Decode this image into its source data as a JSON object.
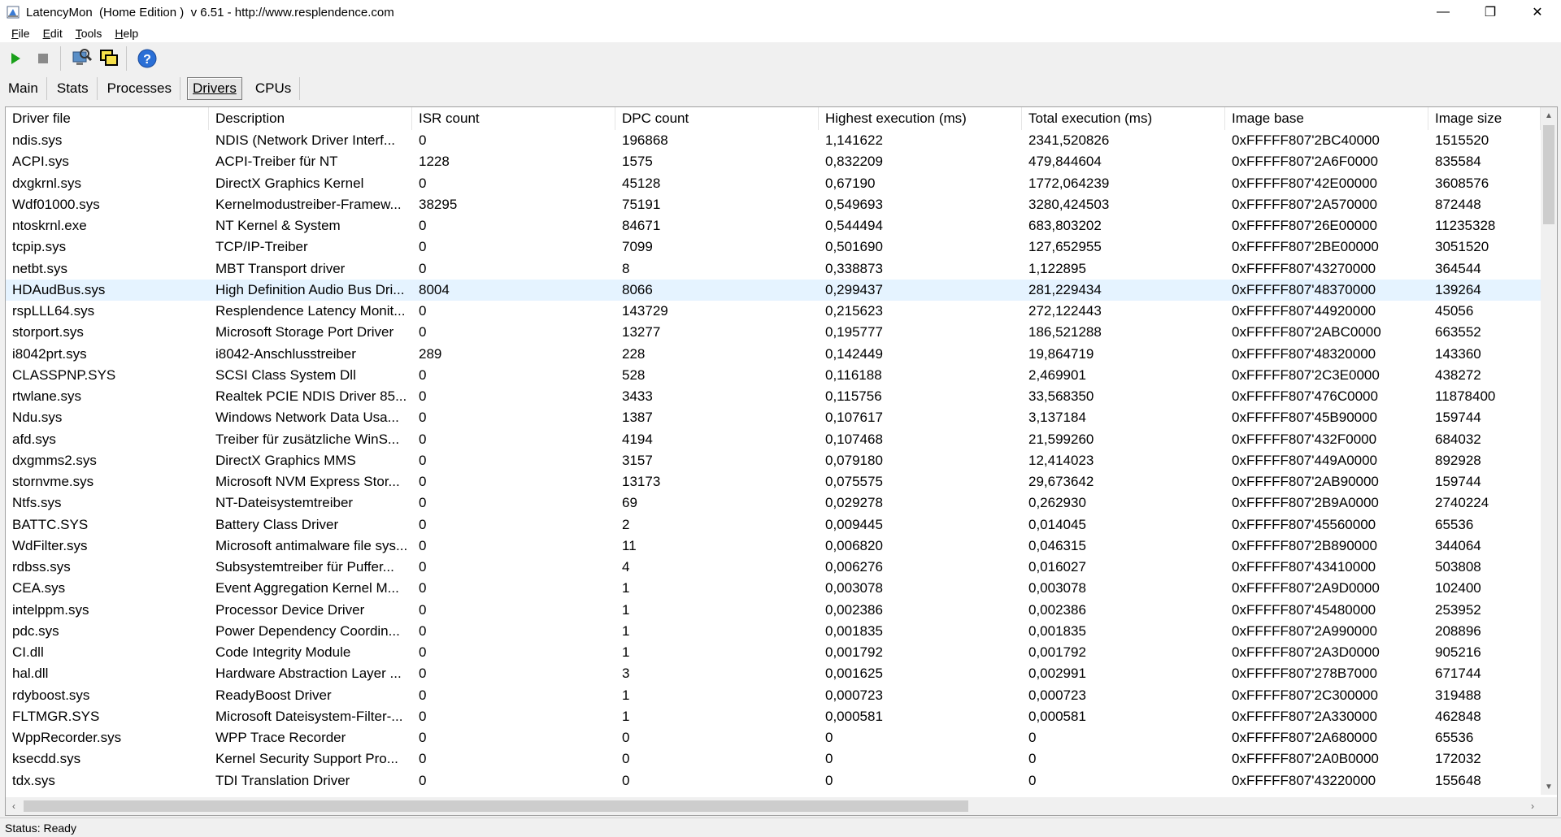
{
  "window": {
    "title": "LatencyMon  (Home Edition )  v 6.51 - http://www.resplendence.com",
    "minimize": "—",
    "restore": "❐",
    "close": "✕"
  },
  "menu": [
    {
      "key": "F",
      "rest": "ile"
    },
    {
      "key": "E",
      "rest": "dit"
    },
    {
      "key": "T",
      "rest": "ools"
    },
    {
      "key": "H",
      "rest": "elp"
    }
  ],
  "toolbar": {
    "icons": [
      "play-icon",
      "stop-icon",
      "search-computer-icon",
      "windows-icon",
      "help-icon"
    ],
    "colors": {
      "play": "#1aa01a",
      "stop": "#8a8a8a",
      "help": "#2a6fd6"
    }
  },
  "tabs": [
    {
      "key": "M",
      "rest": "ain"
    },
    {
      "key": "S",
      "rest": "tats"
    },
    {
      "key": "P",
      "rest": "rocesses"
    },
    {
      "key": "D",
      "rest": "rivers"
    },
    {
      "key": "C",
      "rest": "PUs"
    }
  ],
  "active_tab": "Drivers",
  "table": {
    "columns": [
      "Driver file",
      "Description",
      "ISR count",
      "DPC count",
      "Highest execution (ms)",
      "Total execution (ms)",
      "Image base",
      "Image size"
    ],
    "selected_row": 7,
    "rows": [
      [
        "ndis.sys",
        "NDIS (Network Driver Interf...",
        "0",
        "196868",
        "1,141622",
        "2341,520826",
        "0xFFFFF807'2BC40000",
        "1515520"
      ],
      [
        "ACPI.sys",
        "ACPI-Treiber für NT",
        "1228",
        "1575",
        "0,832209",
        "479,844604",
        "0xFFFFF807'2A6F0000",
        "835584"
      ],
      [
        "dxgkrnl.sys",
        "DirectX Graphics Kernel",
        "0",
        "45128",
        "0,67190",
        "1772,064239",
        "0xFFFFF807'42E00000",
        "3608576"
      ],
      [
        "Wdf01000.sys",
        "Kernelmodustreiber-Framew...",
        "38295",
        "75191",
        "0,549693",
        "3280,424503",
        "0xFFFFF807'2A570000",
        "872448"
      ],
      [
        "ntoskrnl.exe",
        "NT Kernel & System",
        "0",
        "84671",
        "0,544494",
        "683,803202",
        "0xFFFFF807'26E00000",
        "11235328"
      ],
      [
        "tcpip.sys",
        "TCP/IP-Treiber",
        "0",
        "7099",
        "0,501690",
        "127,652955",
        "0xFFFFF807'2BE00000",
        "3051520"
      ],
      [
        "netbt.sys",
        "MBT Transport driver",
        "0",
        "8",
        "0,338873",
        "1,122895",
        "0xFFFFF807'43270000",
        "364544"
      ],
      [
        "HDAudBus.sys",
        "High Definition Audio Bus Dri...",
        "8004",
        "8066",
        "0,299437",
        "281,229434",
        "0xFFFFF807'48370000",
        "139264"
      ],
      [
        "rspLLL64.sys",
        "Resplendence Latency Monit...",
        "0",
        "143729",
        "0,215623",
        "272,122443",
        "0xFFFFF807'44920000",
        "45056"
      ],
      [
        "storport.sys",
        "Microsoft Storage Port Driver",
        "0",
        "13277",
        "0,195777",
        "186,521288",
        "0xFFFFF807'2ABC0000",
        "663552"
      ],
      [
        "i8042prt.sys",
        "i8042-Anschlusstreiber",
        "289",
        "228",
        "0,142449",
        "19,864719",
        "0xFFFFF807'48320000",
        "143360"
      ],
      [
        "CLASSPNP.SYS",
        "SCSI Class System Dll",
        "0",
        "528",
        "0,116188",
        "2,469901",
        "0xFFFFF807'2C3E0000",
        "438272"
      ],
      [
        "rtwlane.sys",
        "Realtek PCIE NDIS Driver 85...",
        "0",
        "3433",
        "0,115756",
        "33,568350",
        "0xFFFFF807'476C0000",
        "11878400"
      ],
      [
        "Ndu.sys",
        "Windows Network Data Usa...",
        "0",
        "1387",
        "0,107617",
        "3,137184",
        "0xFFFFF807'45B90000",
        "159744"
      ],
      [
        "afd.sys",
        "Treiber für zusätzliche WinS...",
        "0",
        "4194",
        "0,107468",
        "21,599260",
        "0xFFFFF807'432F0000",
        "684032"
      ],
      [
        "dxgmms2.sys",
        "DirectX Graphics MMS",
        "0",
        "3157",
        "0,079180",
        "12,414023",
        "0xFFFFF807'449A0000",
        "892928"
      ],
      [
        "stornvme.sys",
        "Microsoft NVM Express Stor...",
        "0",
        "13173",
        "0,075575",
        "29,673642",
        "0xFFFFF807'2AB90000",
        "159744"
      ],
      [
        "Ntfs.sys",
        "NT-Dateisystemtreiber",
        "0",
        "69",
        "0,029278",
        "0,262930",
        "0xFFFFF807'2B9A0000",
        "2740224"
      ],
      [
        "BATTC.SYS",
        "Battery Class Driver",
        "0",
        "2",
        "0,009445",
        "0,014045",
        "0xFFFFF807'45560000",
        "65536"
      ],
      [
        "WdFilter.sys",
        "Microsoft antimalware file sys...",
        "0",
        "11",
        "0,006820",
        "0,046315",
        "0xFFFFF807'2B890000",
        "344064"
      ],
      [
        "rdbss.sys",
        "Subsystemtreiber für Puffer...",
        "0",
        "4",
        "0,006276",
        "0,016027",
        "0xFFFFF807'43410000",
        "503808"
      ],
      [
        "CEA.sys",
        "Event Aggregation Kernel M...",
        "0",
        "1",
        "0,003078",
        "0,003078",
        "0xFFFFF807'2A9D0000",
        "102400"
      ],
      [
        "intelppm.sys",
        "Processor Device Driver",
        "0",
        "1",
        "0,002386",
        "0,002386",
        "0xFFFFF807'45480000",
        "253952"
      ],
      [
        "pdc.sys",
        "Power Dependency Coordin...",
        "0",
        "1",
        "0,001835",
        "0,001835",
        "0xFFFFF807'2A990000",
        "208896"
      ],
      [
        "CI.dll",
        "Code Integrity Module",
        "0",
        "1",
        "0,001792",
        "0,001792",
        "0xFFFFF807'2A3D0000",
        "905216"
      ],
      [
        "hal.dll",
        "Hardware Abstraction Layer ...",
        "0",
        "3",
        "0,001625",
        "0,002991",
        "0xFFFFF807'278B7000",
        "671744"
      ],
      [
        "rdyboost.sys",
        "ReadyBoost Driver",
        "0",
        "1",
        "0,000723",
        "0,000723",
        "0xFFFFF807'2C300000",
        "319488"
      ],
      [
        "FLTMGR.SYS",
        "Microsoft Dateisystem-Filter-...",
        "0",
        "1",
        "0,000581",
        "0,000581",
        "0xFFFFF807'2A330000",
        "462848"
      ],
      [
        "WppRecorder.sys",
        "WPP Trace Recorder",
        "0",
        "0",
        "0",
        "0",
        "0xFFFFF807'2A680000",
        "65536"
      ],
      [
        "ksecdd.sys",
        "Kernel Security Support Pro...",
        "0",
        "0",
        "0",
        "0",
        "0xFFFFF807'2A0B0000",
        "172032"
      ],
      [
        "tdx.sys",
        "TDI Translation Driver",
        "0",
        "0",
        "0",
        "0",
        "0xFFFFF807'43220000",
        "155648"
      ]
    ]
  },
  "status": "Status: Ready"
}
